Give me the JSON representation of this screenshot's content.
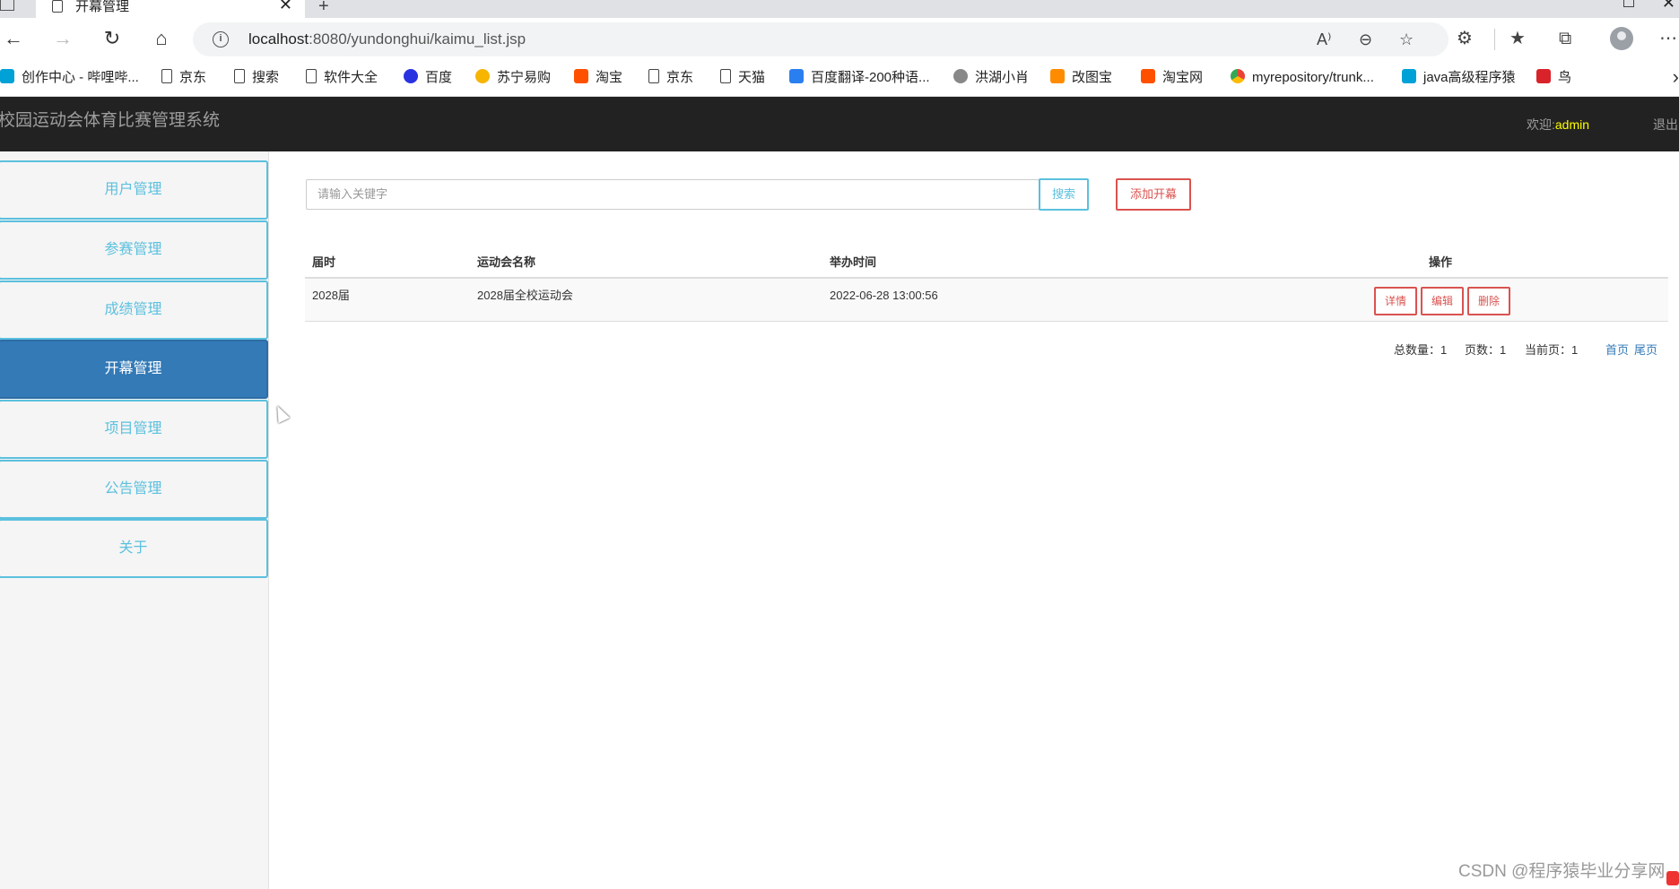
{
  "browser": {
    "tab_title": "开幕管理",
    "tab_close": "✕",
    "new_tab": "+",
    "url_host": "localhost",
    "url_rest": ":8080/yundonghui/kaimu_list.jsp",
    "window_close": "✕",
    "bookmarks": [
      {
        "label": "创作中心 - 哔哩哔...",
        "icon": "bilibili-icon"
      },
      {
        "label": "京东",
        "icon": "page-icon"
      },
      {
        "label": "搜索",
        "icon": "page-icon"
      },
      {
        "label": "软件大全",
        "icon": "page-icon"
      },
      {
        "label": "百度",
        "icon": "baidu-icon"
      },
      {
        "label": "苏宁易购",
        "icon": "suning-icon"
      },
      {
        "label": "淘宝",
        "icon": "taobao-icon"
      },
      {
        "label": "京东",
        "icon": "page-icon"
      },
      {
        "label": "天猫",
        "icon": "page-icon"
      },
      {
        "label": "百度翻译-200种语...",
        "icon": "fanyi-icon"
      },
      {
        "label": "洪湖小肖",
        "icon": "bird-icon"
      },
      {
        "label": "改图宝",
        "icon": "gaitubao-icon"
      },
      {
        "label": "淘宝网",
        "icon": "taobao-icon"
      },
      {
        "label": "myrepository/trunk...",
        "icon": "chrome-icon"
      },
      {
        "label": "java高级程序猿",
        "icon": "bilibili-icon"
      },
      {
        "label": "鸟",
        "icon": "bird-red-icon"
      }
    ]
  },
  "header": {
    "title": "校园运动会体育比赛管理系统",
    "welcome_label": "欢迎:",
    "username": "admin",
    "logout": "退出"
  },
  "sidebar": {
    "items": [
      {
        "label": "用户管理",
        "active": false
      },
      {
        "label": "参赛管理",
        "active": false
      },
      {
        "label": "成绩管理",
        "active": false
      },
      {
        "label": "开幕管理",
        "active": true
      },
      {
        "label": "项目管理",
        "active": false
      },
      {
        "label": "公告管理",
        "active": false
      },
      {
        "label": "关于",
        "active": false
      }
    ]
  },
  "search": {
    "placeholder": "请输入关键字",
    "button": "搜索",
    "add_button": "添加开幕"
  },
  "table": {
    "columns": [
      "届时",
      "运动会名称",
      "举办时间",
      "操作"
    ],
    "rows": [
      {
        "session": "2028届",
        "name": "2028届全校运动会",
        "time": "2022-06-28 13:00:56"
      }
    ],
    "actions": {
      "detail": "详情",
      "edit": "编辑",
      "delete": "删除"
    }
  },
  "pager": {
    "total": "总数量：1",
    "pages": "页数：1",
    "current": "当前页：1",
    "first": "首页",
    "last": "尾页"
  },
  "watermark": "CSDN @程序猿毕业分享网",
  "colors": {
    "header_bg": "#222222",
    "accent_info": "#5bc0de",
    "accent_danger": "#d9534f",
    "active_menu": "#337ab7",
    "welcome_user": "#ffff00"
  }
}
